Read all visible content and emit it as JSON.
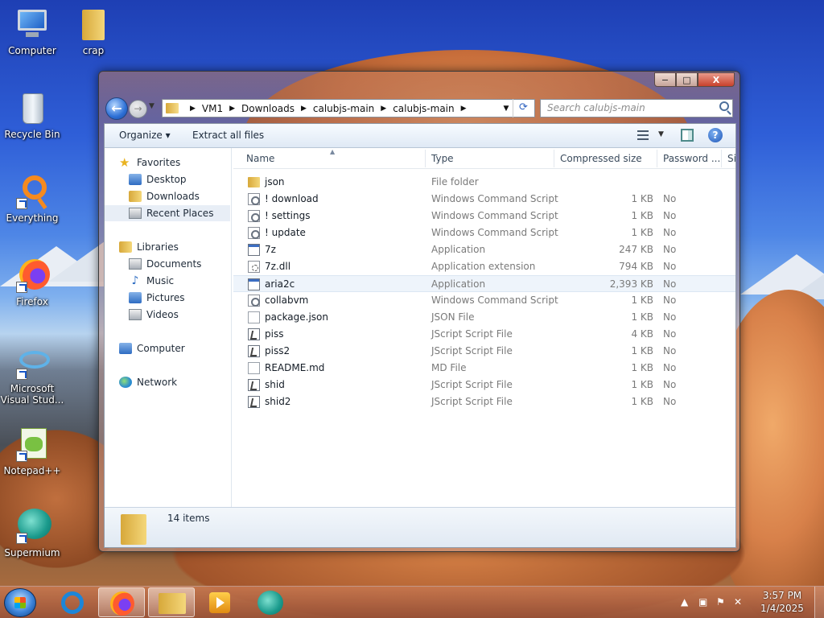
{
  "desktop": {
    "icons": [
      {
        "label": "Computer",
        "icon": "computer-icon"
      },
      {
        "label": "crap",
        "icon": "folder-icon"
      },
      {
        "label": "Recycle Bin",
        "icon": "recycle-bin-icon"
      },
      {
        "label": "Everything",
        "icon": "everything-search-icon"
      },
      {
        "label": "Firefox",
        "icon": "firefox-icon"
      },
      {
        "label": "Microsoft Visual Stud...",
        "icon": "visual-studio-icon"
      },
      {
        "label": "Notepad++",
        "icon": "notepad-plus-plus-icon"
      },
      {
        "label": "Supermium",
        "icon": "supermium-icon"
      }
    ]
  },
  "window": {
    "caption": {
      "minimize": "−",
      "maximize": "□",
      "close": "X"
    },
    "address": {
      "crumbs": [
        "VM1",
        "Downloads",
        "calubjs-main",
        "calubjs-main"
      ]
    },
    "search": {
      "placeholder": "Search calubjs-main"
    },
    "toolbar": {
      "organize": "Organize",
      "extract": "Extract all files"
    },
    "nav": {
      "favorites": {
        "label": "Favorites",
        "items": [
          "Desktop",
          "Downloads",
          "Recent Places"
        ]
      },
      "libraries": {
        "label": "Libraries",
        "items": [
          "Documents",
          "Music",
          "Pictures",
          "Videos"
        ]
      },
      "computer": "Computer",
      "network": "Network"
    },
    "columns": {
      "name": "Name",
      "type": "Type",
      "size": "Compressed size",
      "password": "Password ...",
      "extra": "Si"
    },
    "files": [
      {
        "name": "json",
        "type": "File folder",
        "size": "",
        "password": "",
        "icon": "folder"
      },
      {
        "name": "! download",
        "type": "Windows Command Script",
        "size": "1 KB",
        "password": "No",
        "icon": "script"
      },
      {
        "name": "! settings",
        "type": "Windows Command Script",
        "size": "1 KB",
        "password": "No",
        "icon": "script"
      },
      {
        "name": "! update",
        "type": "Windows Command Script",
        "size": "1 KB",
        "password": "No",
        "icon": "script"
      },
      {
        "name": "7z",
        "type": "Application",
        "size": "247 KB",
        "password": "No",
        "icon": "app"
      },
      {
        "name": "7z.dll",
        "type": "Application extension",
        "size": "794 KB",
        "password": "No",
        "icon": "dll"
      },
      {
        "name": "aria2c",
        "type": "Application",
        "size": "2,393 KB",
        "password": "No",
        "icon": "app"
      },
      {
        "name": "collabvm",
        "type": "Windows Command Script",
        "size": "1 KB",
        "password": "No",
        "icon": "script"
      },
      {
        "name": "package.json",
        "type": "JSON File",
        "size": "1 KB",
        "password": "No",
        "icon": "blank"
      },
      {
        "name": "piss",
        "type": "JScript Script File",
        "size": "4 KB",
        "password": "No",
        "icon": "js"
      },
      {
        "name": "piss2",
        "type": "JScript Script File",
        "size": "1 KB",
        "password": "No",
        "icon": "js"
      },
      {
        "name": "README.md",
        "type": "MD File",
        "size": "1 KB",
        "password": "No",
        "icon": "blank"
      },
      {
        "name": "shid",
        "type": "JScript Script File",
        "size": "1 KB",
        "password": "No",
        "icon": "js"
      },
      {
        "name": "shid2",
        "type": "JScript Script File",
        "size": "1 KB",
        "password": "No",
        "icon": "js"
      }
    ],
    "status": {
      "count": "14 items"
    }
  },
  "taskbar": {
    "apps": [
      "internet-explorer-icon",
      "firefox-icon",
      "file-explorer-icon",
      "media-player-icon",
      "supermium-icon"
    ],
    "clock": {
      "time": "3:57 PM",
      "date": "1/4/2025"
    }
  }
}
